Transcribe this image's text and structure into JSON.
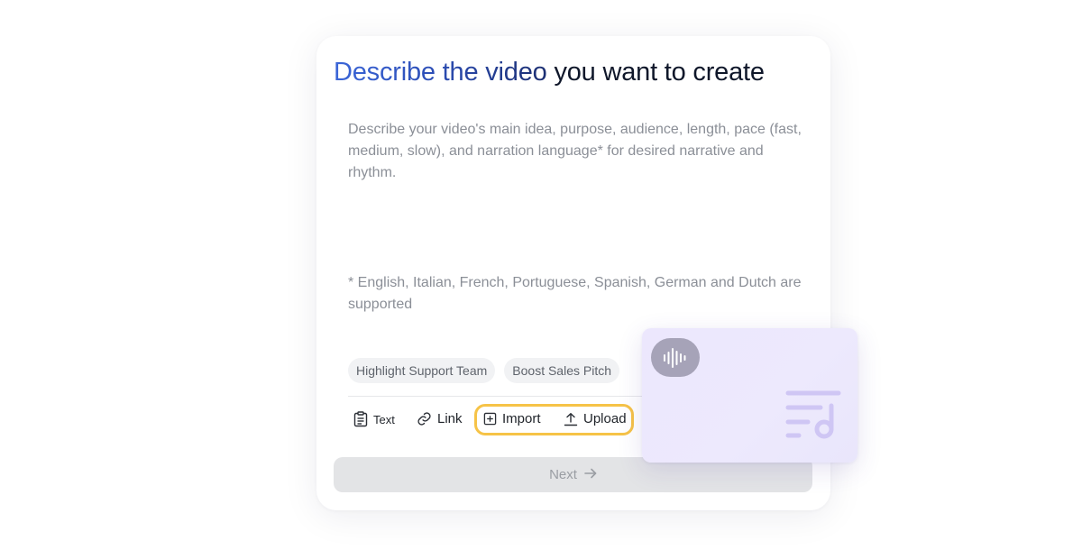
{
  "card": {
    "title_part1": "Describe the video",
    "title_part2": "you want to create",
    "placeholder": "Describe your video's main idea, purpose, audience, length, pace (fast, medium, slow), and narration language* for desired narrative and rhythm.",
    "note": "* English, Italian, French, Portuguese, Spanish, German and Dutch are supported"
  },
  "suggestions": [
    "Highlight Support Team",
    "Boost Sales Pitch"
  ],
  "toolbar": {
    "text_label": "Text",
    "link_label": "Link",
    "import_label": "Import",
    "upload_label": "Upload",
    "highlight_color": "#f6c347"
  },
  "next_button": {
    "label": "Next"
  },
  "audio_card": {
    "icons": [
      "audio-waveform-icon",
      "music-playlist-icon"
    ],
    "background": "#ece7fd"
  },
  "colors": {
    "title_gradient_start": "#3b66d8",
    "title_gradient_end": "#1c2f72",
    "title_dark": "#0f172a",
    "muted_text": "#8b8f97"
  }
}
